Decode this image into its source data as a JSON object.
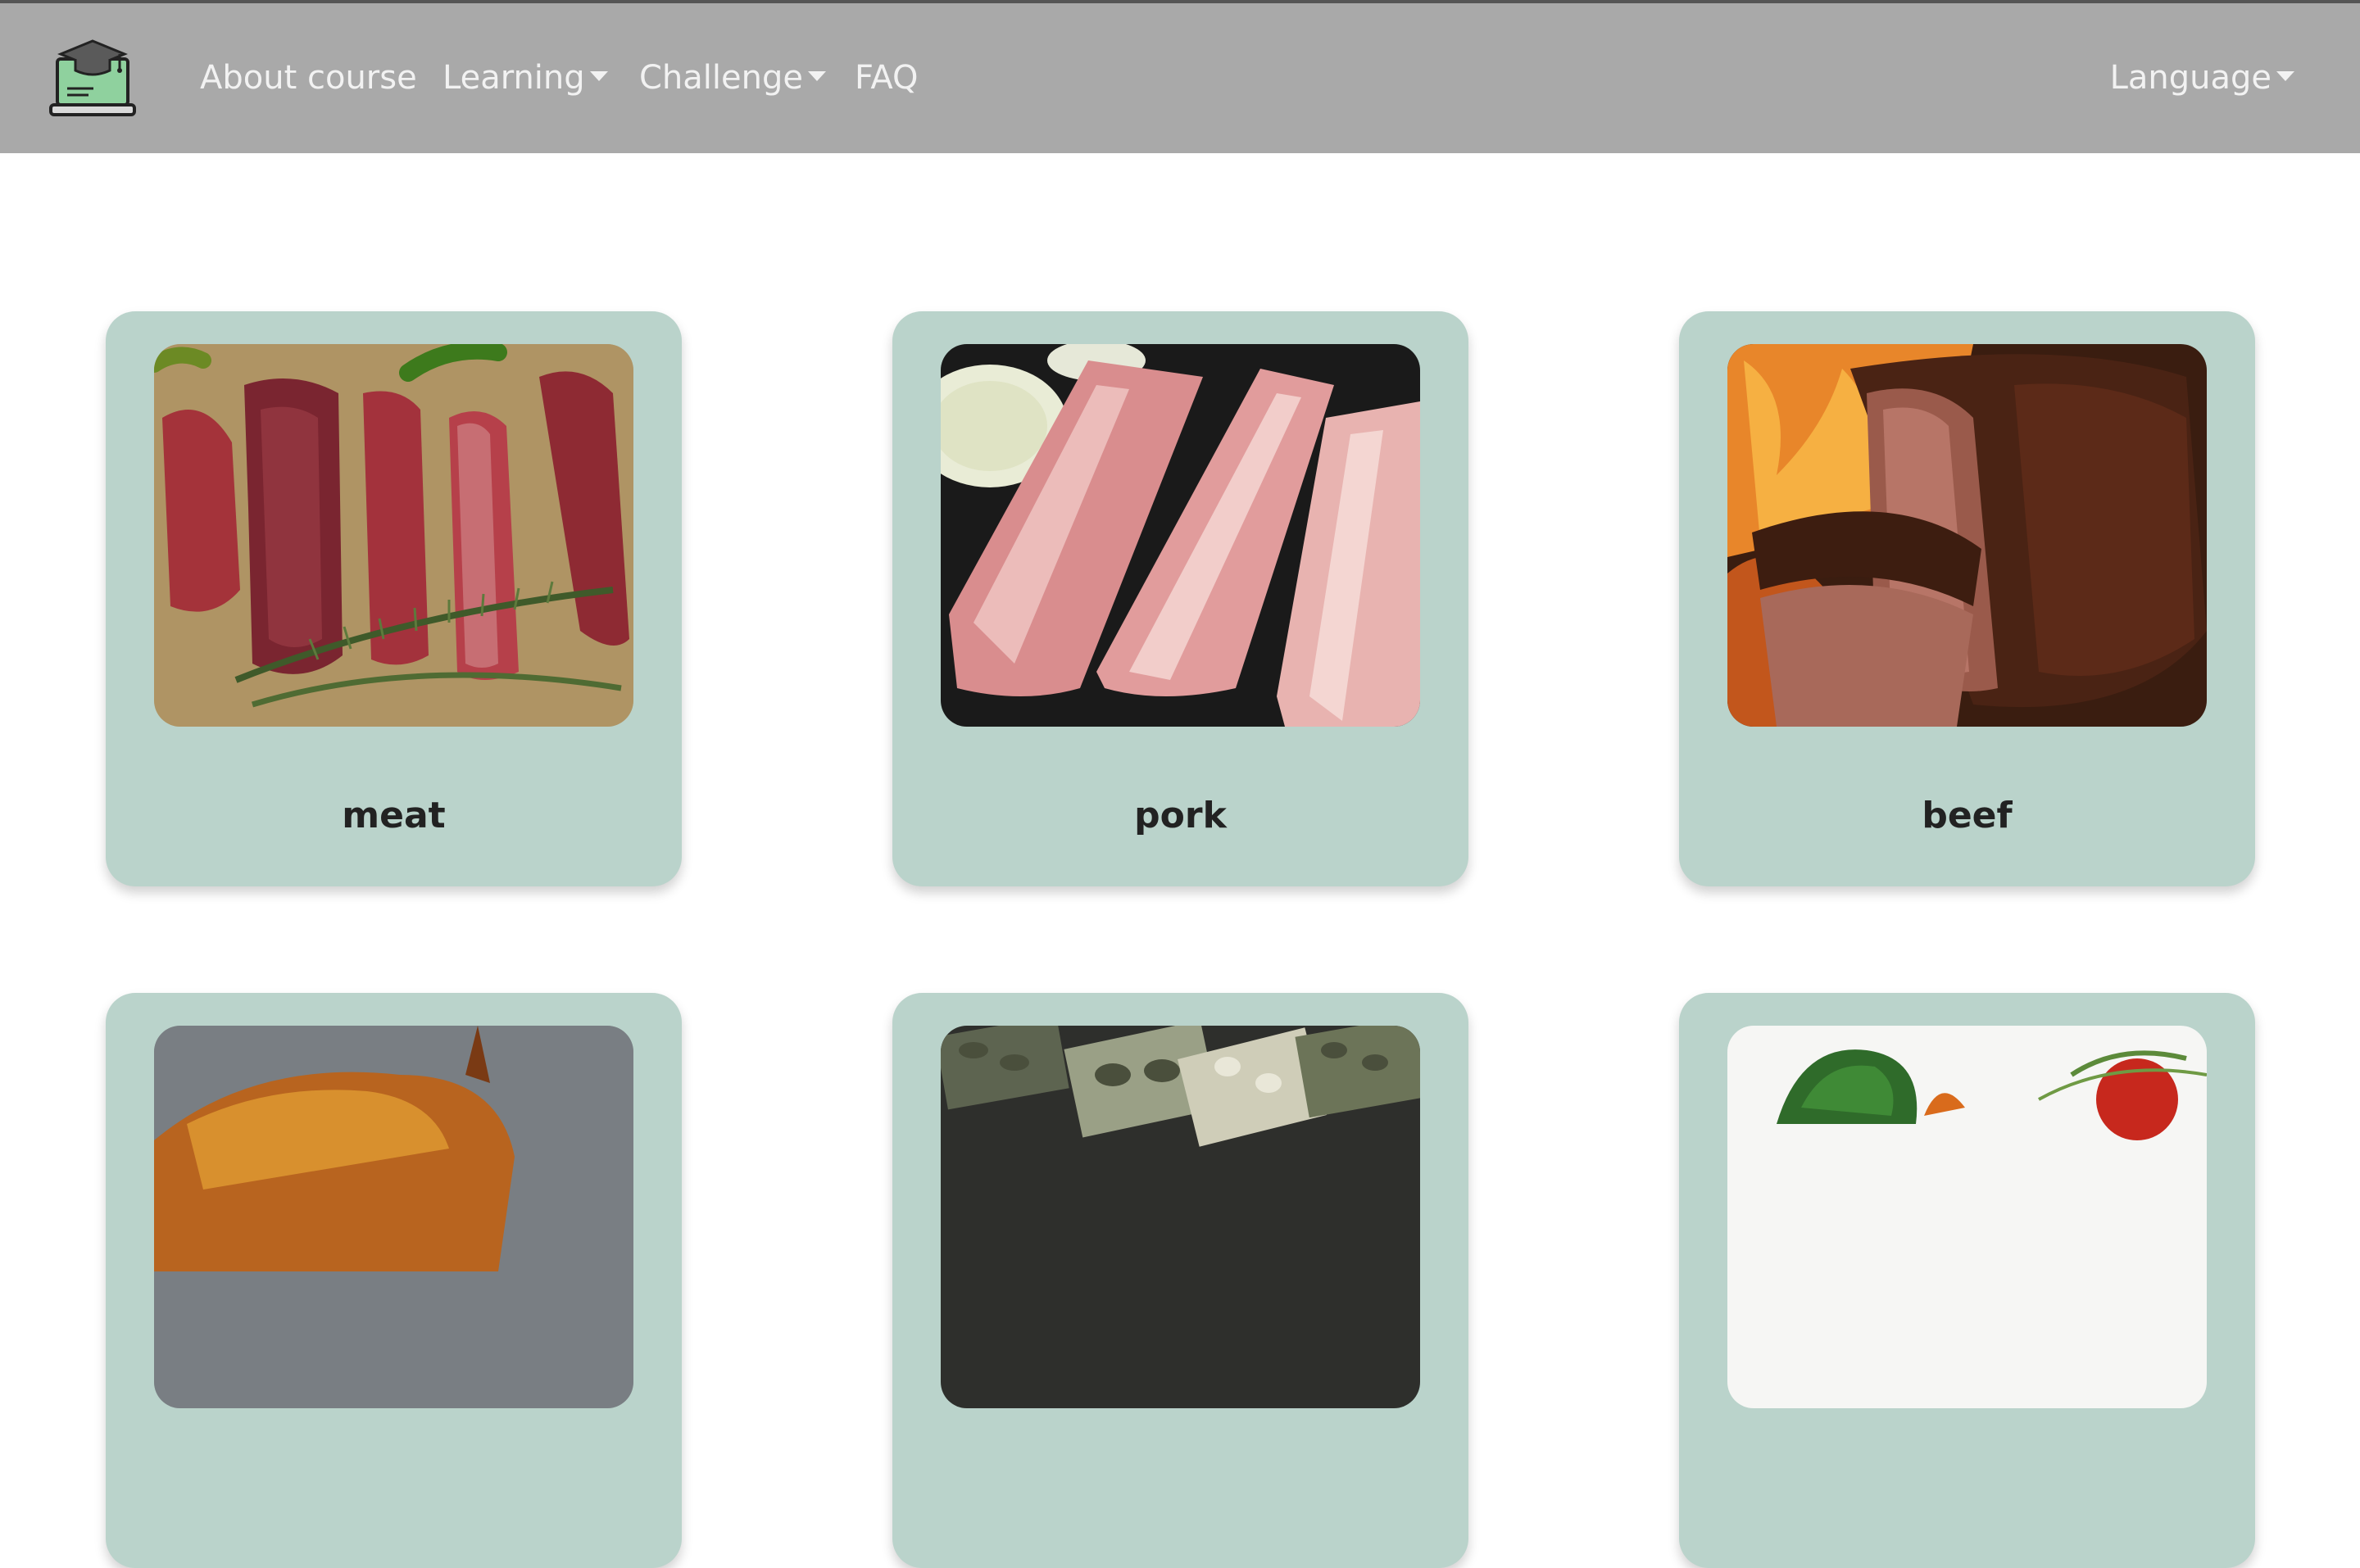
{
  "nav": {
    "about_label": "About course",
    "learning_label": "Learning",
    "challenge_label": "Challenge",
    "faq_label": "FAQ",
    "language_label": "Language"
  },
  "colors": {
    "navbar_bg": "#a9a9a9",
    "card_bg": "#bad3cb",
    "nav_text": "#f2f2f2"
  },
  "cards": [
    {
      "label": "meat",
      "image": "raw-meat-cuts-image"
    },
    {
      "label": "pork",
      "image": "pork-belly-image"
    },
    {
      "label": "beef",
      "image": "roast-beef-image"
    },
    {
      "label": "",
      "image": "roast-chicken-image"
    },
    {
      "label": "",
      "image": "seafood-shellfish-image"
    },
    {
      "label": "",
      "image": "vegetables-image"
    }
  ]
}
